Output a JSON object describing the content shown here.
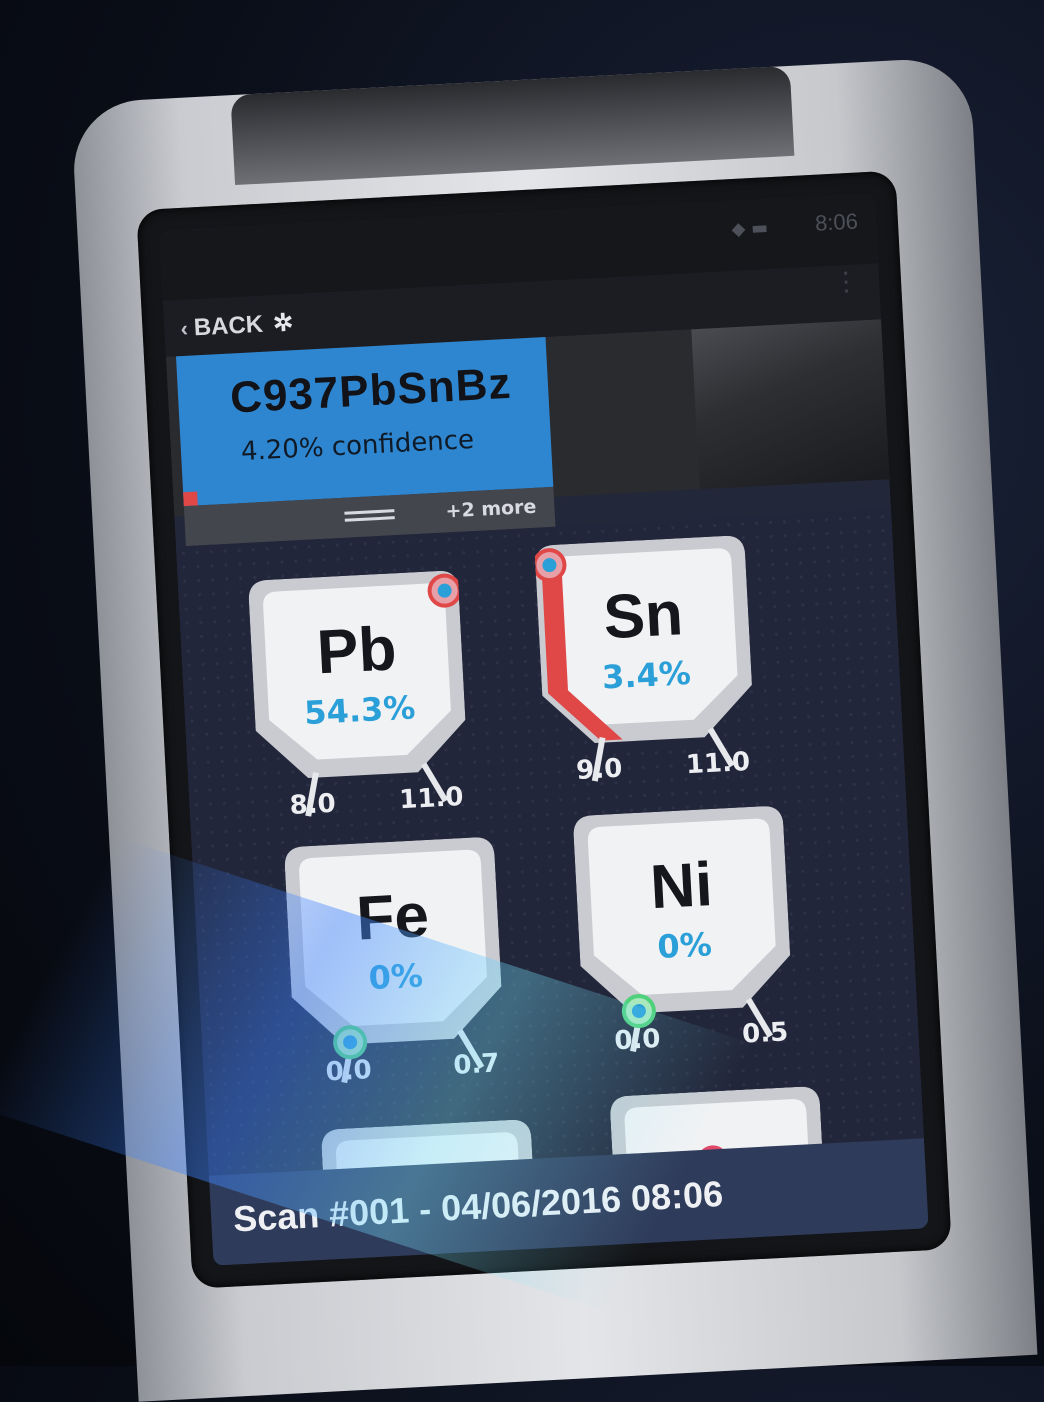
{
  "status": {
    "time": "8:06"
  },
  "nav": {
    "back_label": "BACK"
  },
  "result": {
    "alloy": "C937PbSnBz",
    "confidence": "4.20% confidence",
    "more": "+2 more"
  },
  "elements": [
    {
      "symbol": "Pb",
      "percent": "54.3%",
      "low": "8.0",
      "high": "11.0"
    },
    {
      "symbol": "Sn",
      "percent": "3.4%",
      "low": "9.0",
      "high": "11.0"
    },
    {
      "symbol": "Fe",
      "percent": "0%",
      "low": "0.0",
      "high": "0.7"
    },
    {
      "symbol": "Ni",
      "percent": "0%",
      "low": "0.0",
      "high": "0.5"
    }
  ],
  "scan": {
    "label": "Scan #001 - 04/06/2016 08:06"
  },
  "colors": {
    "accent": "#2f86d0",
    "value": "#2b9fd8",
    "alert": "#e04848",
    "ok": "#4fd07a"
  }
}
